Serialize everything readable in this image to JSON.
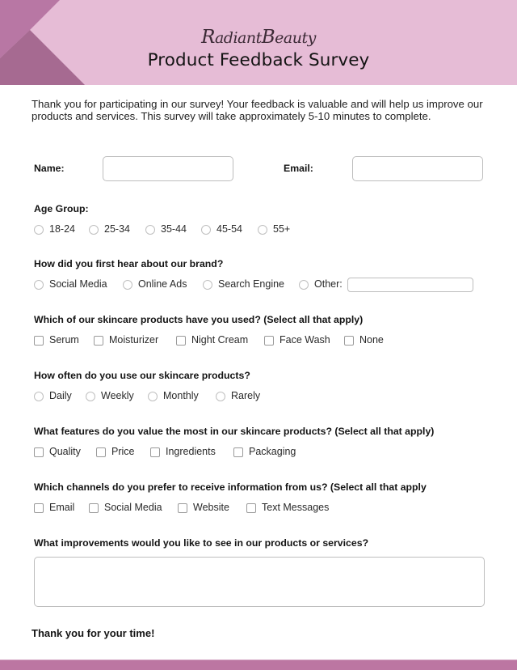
{
  "header": {
    "brand": {
      "first_cap": "R",
      "first_rest": "adiant",
      "second_cap": "B",
      "second_rest": "eauty"
    },
    "title": "Product Feedback Survey",
    "colors": {
      "banner": "#e6bcd6",
      "shape_light": "#b877a4",
      "shape_dark": "#a66a91",
      "footer": "#bc76a2"
    }
  },
  "intro": "Thank you for participating in our survey! Your feedback is valuable and will help us improve our products and services. This survey will take approximately 5-10 minutes to complete.",
  "contact": {
    "name_label": "Name:",
    "name_value": "",
    "email_label": "Email:",
    "email_value": ""
  },
  "questions": [
    {
      "label": "Age Group:",
      "type": "radio",
      "options": [
        "18-24",
        "25-34",
        "35-44",
        "45-54",
        "55+"
      ]
    },
    {
      "label": "How did you first hear about our brand?",
      "type": "radio",
      "options": [
        "Social Media",
        "Online Ads",
        "Search Engine",
        "Other:"
      ],
      "other_value": ""
    },
    {
      "label": "Which of our skincare products have you used? (Select all that apply)",
      "type": "checkbox",
      "options": [
        "Serum",
        "Moisturizer",
        "Night Cream",
        "Face Wash",
        "None"
      ]
    },
    {
      "label": "How often do you use our skincare products?",
      "type": "radio",
      "options": [
        "Daily",
        "Weekly",
        "Monthly",
        "Rarely"
      ]
    },
    {
      "label": "What features do you value the most in our skincare products? (Select all that apply)",
      "type": "checkbox",
      "options": [
        "Quality",
        "Price",
        "Ingredients",
        "Packaging"
      ]
    },
    {
      "label": "Which channels do you prefer to receive information from us? (Select all that apply",
      "type": "checkbox",
      "options": [
        "Email",
        "Social Media",
        "Website",
        "Text Messages"
      ]
    },
    {
      "label": "What improvements would you like to see in our products or services?",
      "type": "textarea",
      "value": ""
    }
  ],
  "closing": "Thank you for your time!"
}
